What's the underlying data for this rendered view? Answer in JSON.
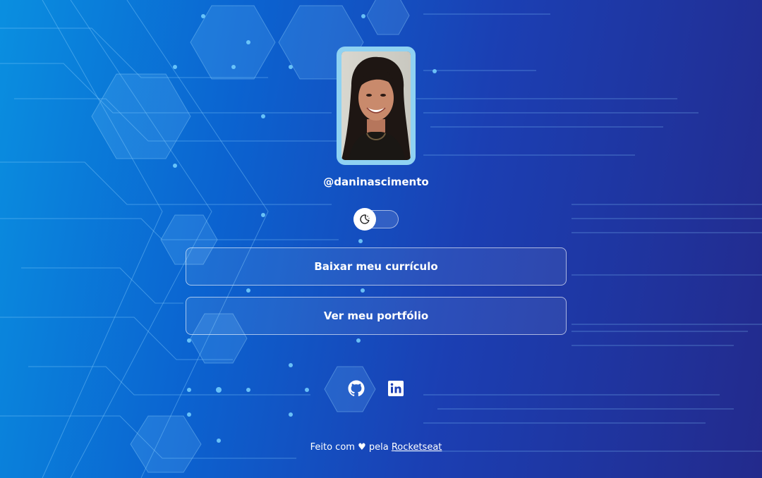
{
  "profile": {
    "avatar_icon": "profile-photo",
    "handle": "@daninascimento"
  },
  "theme_toggle": {
    "icon": "moon-icon",
    "state": "off"
  },
  "links": [
    {
      "label": "Baixar meu currículo"
    },
    {
      "label": "Ver meu portfólio"
    }
  ],
  "social": {
    "github_icon": "github-icon",
    "linkedin_icon": "linkedin-icon"
  },
  "footer": {
    "prefix": "Feito com",
    "heart": "♥",
    "middle": "pela",
    "link_text": "Rocketseat"
  },
  "colors": {
    "background_start": "#0a8fe0",
    "background_end": "#232a8c",
    "photo_border": "#8fd2f2",
    "text": "#ffffff"
  }
}
